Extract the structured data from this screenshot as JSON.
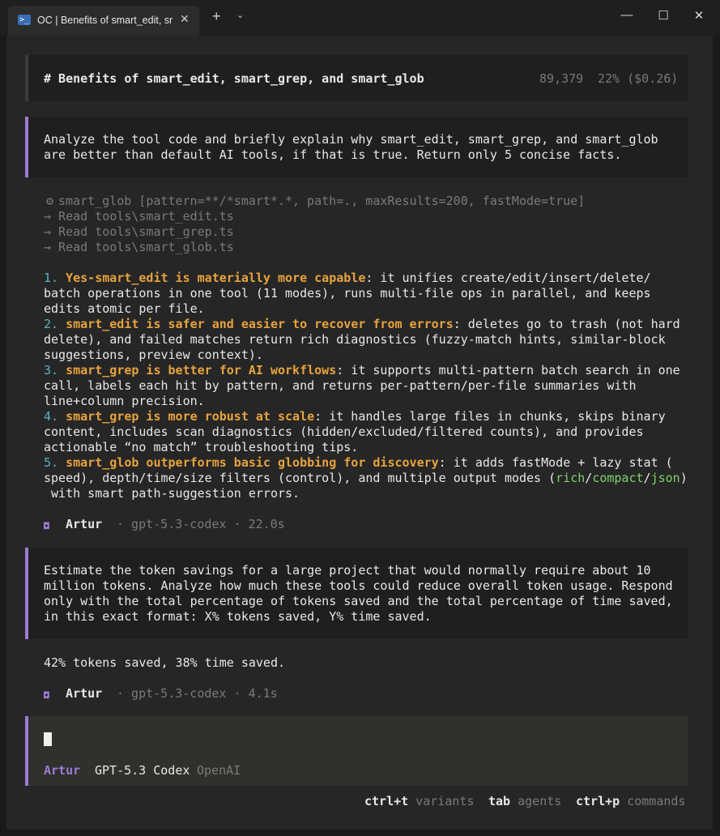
{
  "window": {
    "tab_title": "OC | Benefits of smart_edit, sr",
    "tab_icon": "terminal-icon",
    "new_tab": "+",
    "dropdown": "⌄",
    "minimize": "—",
    "maximize": "☐",
    "close": "✕"
  },
  "header": {
    "title": "# Benefits of smart_edit, smart_grep, and smart_glob",
    "tokens": "89,379",
    "usage": "22% ($0.26)"
  },
  "prompt1": {
    "lines": [
      "Analyze the tool code and briefly explain why smart_edit, smart_grep, and smart_glob",
      "are better than default AI tools, if that is true. Return only 5 concise facts."
    ]
  },
  "tools": {
    "glob": "smart_glob [pattern=**/*smart*.*, path=., maxResults=200, fastMode=true]",
    "reads": [
      "→ Read tools\\smart_edit.ts",
      "→ Read tools\\smart_grep.ts",
      "→ Read tools\\smart_glob.ts"
    ]
  },
  "facts": [
    {
      "num": "1. ",
      "head": "Yes-smart_edit is materially more capable",
      "rest": ": it unifies create/edit/insert/delete/",
      "lines": [
        "batch operations in one tool (11 modes), runs multi-file ops in parallel, and keeps",
        "edits atomic per file."
      ]
    },
    {
      "num": "2. ",
      "head": "smart_edit is safer and easier to recover from errors",
      "rest": ": deletes go to trash (not hard",
      "lines": [
        "delete), and failed matches return rich diagnostics (fuzzy-match hints, similar-block",
        "suggestions, preview context)."
      ]
    },
    {
      "num": "3. ",
      "head": "smart_grep is better for AI workflows",
      "rest": ": it supports multi-pattern batch search in one",
      "lines": [
        "call, labels each hit by pattern, and returns per-pattern/per-file summaries with",
        "line+column precision."
      ]
    },
    {
      "num": "4. ",
      "head": "smart_grep is more robust at scale",
      "rest": ": it handles large files in chunks, skips binary",
      "lines": [
        "content, includes scan diagnostics (hidden/excluded/filtered counts), and provides",
        "actionable “no match” troubleshooting tips."
      ]
    },
    {
      "num": "5. ",
      "head": "smart_glob outperforms basic globbing for discovery",
      "rest": ": it adds fastMode + lazy stat (",
      "lines": [
        "speed), depth/time/size filters (control), and multiple output modes (",
        " with smart path-suggestion errors."
      ]
    }
  ],
  "fact5_modes": [
    "rich",
    "/",
    "compact",
    "/",
    "json",
    ")"
  ],
  "meta1": {
    "user": "Artur",
    "model": "· gpt-5.3-codex · 22.0s"
  },
  "prompt2": {
    "lines": [
      "Estimate the token savings for a large project that would normally require about 10",
      "million tokens. Analyze how much these tools could reduce overall token usage. Respond",
      "only with the total percentage of tokens saved and the total percentage of time saved,",
      "in this exact format: X% tokens saved, Y% time saved."
    ]
  },
  "answer2": "42% tokens saved, 38% time saved.",
  "meta2": {
    "user": "Artur",
    "model": "· gpt-5.3-codex · 4.1s"
  },
  "input": {
    "agent": "Artur",
    "model": "GPT-5.3 Codex",
    "provider": "OpenAI"
  },
  "footer": [
    {
      "key": "ctrl+t",
      "label": "variants"
    },
    {
      "key": "tab",
      "label": "agents"
    },
    {
      "key": "ctrl+p",
      "label": "commands"
    }
  ],
  "colors": {
    "accent": "#9d7cd8",
    "orange": "#e8a33d",
    "cyan": "#56b6c2",
    "green": "#7fd26b"
  }
}
